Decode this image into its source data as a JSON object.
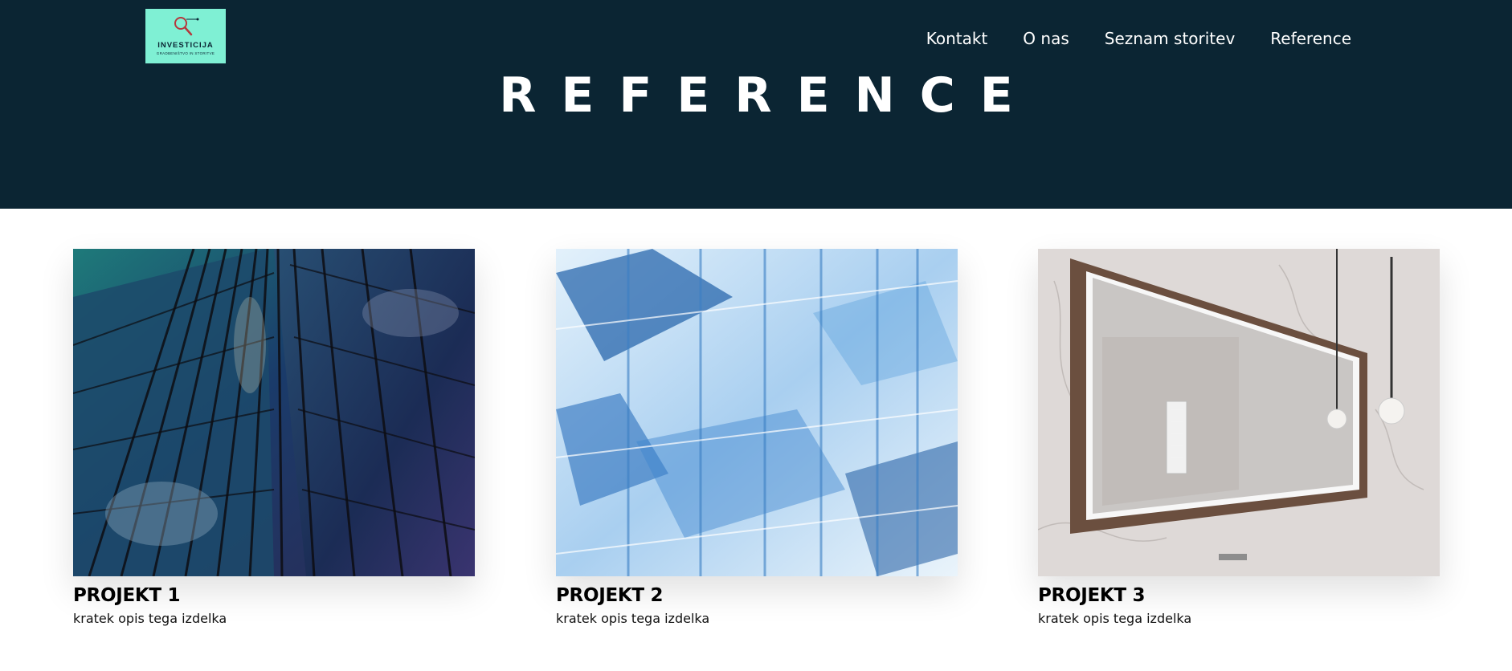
{
  "brand": {
    "name": "INVESTICIJA",
    "tagline": "GRADBENIŠTVO IN STORITVE",
    "bg_color": "#7ff0d4"
  },
  "nav": {
    "items": [
      {
        "label": "Kontakt"
      },
      {
        "label": "O nas"
      },
      {
        "label": "Seznam storitev"
      },
      {
        "label": "Reference"
      }
    ]
  },
  "hero": {
    "title": "REFERENCE",
    "bg_color": "#0b2533"
  },
  "projects": [
    {
      "title": "PROJEKT 1",
      "description": "kratek opis tega izdelka",
      "image": "glass-skyscraper-photo"
    },
    {
      "title": "PROJEKT 2",
      "description": "kratek opis tega izdelka",
      "image": "blue-glass-structure-photo"
    },
    {
      "title": "PROJEKT 3",
      "description": "kratek opis tega izdelka",
      "image": "marble-bathroom-mirror-photo"
    }
  ]
}
